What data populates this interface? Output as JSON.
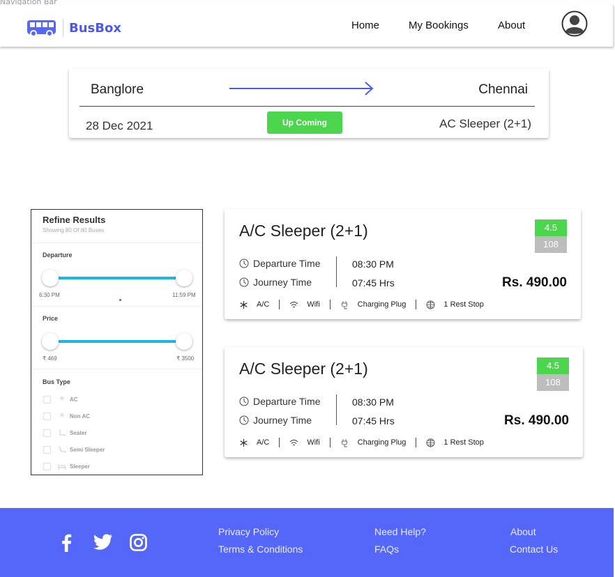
{
  "frame_label": "Navigation Bar",
  "header": {
    "brand": "BusBox",
    "nav": {
      "home": "Home",
      "bookings": "My Bookings",
      "about": "About"
    }
  },
  "trip": {
    "from": "Banglore",
    "to": "Chennai",
    "date": "28 Dec 2021",
    "status": "Up Coming",
    "bus_type": "AC Sleeper (2+1)"
  },
  "filters": {
    "title": "Refine Results",
    "subtitle": "Showing 80 Of 80 Buses",
    "departure": {
      "label": "Departure",
      "min_label": "6:30 PM",
      "max_label": "11:59 PM",
      "range": [
        0.0,
        1.0
      ]
    },
    "price": {
      "label": "Price",
      "min_label": "₹ 469",
      "max_label": "₹ 3500",
      "range": [
        0.0,
        1.0
      ]
    },
    "bus_type": {
      "label": "Bus Type",
      "options": [
        {
          "label": "AC",
          "icon": "snowflake-icon",
          "checked": false
        },
        {
          "label": "Non AC",
          "icon": "snowflake-off-icon",
          "checked": false
        },
        {
          "label": "Seater",
          "icon": "seat-icon",
          "checked": false
        },
        {
          "label": "Semi Sleeper",
          "icon": "recline-seat-icon",
          "checked": false
        },
        {
          "label": "Sleeper",
          "icon": "bed-icon",
          "checked": false
        }
      ]
    }
  },
  "buses": [
    {
      "name": "A/C Sleeper (2+1)",
      "rating": "4.5",
      "reviews": "108",
      "departure_label": "Departure Time",
      "departure_time": "08:30 PM",
      "journey_label": "Journey Time",
      "journey_time": "07:45 Hrs",
      "price": "Rs. 490.00",
      "amenities": [
        "A/C",
        "Wifi",
        "Charging Plug",
        "1 Rest Stop"
      ]
    },
    {
      "name": "A/C Sleeper (2+1)",
      "rating": "4.5",
      "reviews": "108",
      "departure_label": "Departure Time",
      "departure_time": "08:30 PM",
      "journey_label": "Journey Time",
      "journey_time": "07:45 Hrs",
      "price": "Rs. 490.00",
      "amenities": [
        "A/C",
        "Wifi",
        "Charging Plug",
        "1 Rest Stop"
      ]
    }
  ],
  "footer": {
    "social": [
      "facebook-icon",
      "twitter-icon",
      "instagram-icon"
    ],
    "links": {
      "privacy": "Privacy Policy",
      "terms": "Terms & Conditions",
      "help": "Need Help?",
      "faqs": "FAQs",
      "about": "About",
      "contact": "Contact Us"
    }
  },
  "colors": {
    "brand": "#4b5ae8",
    "footer_bg": "#5467f9",
    "status_green": "#4cd64e",
    "slider": "#1ab6e8"
  }
}
